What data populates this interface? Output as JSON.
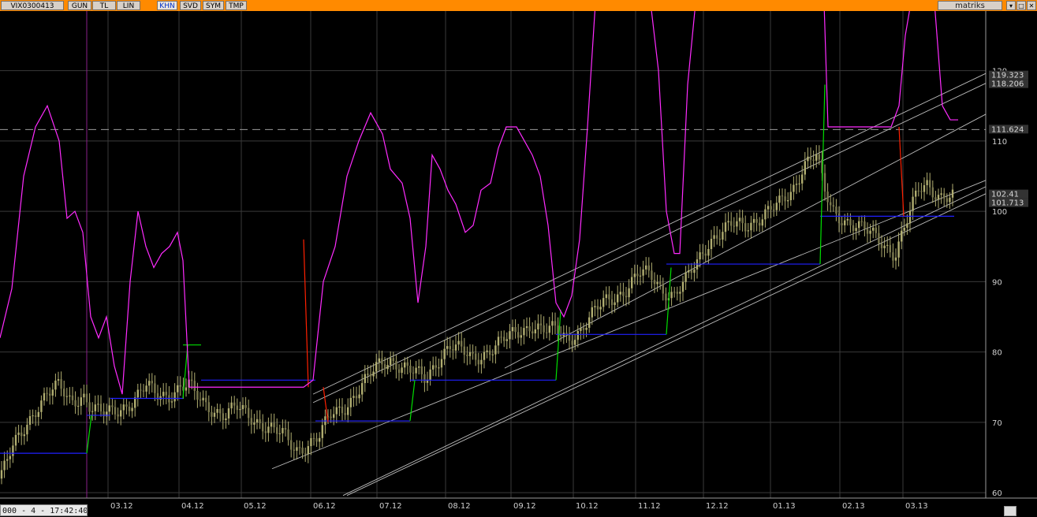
{
  "toolbar": {
    "symbol": "VIX0300413",
    "tabs": [
      "GUN",
      "TL",
      "LIN",
      "KHN",
      "SVD",
      "SYM",
      "TMP"
    ],
    "active_tab": "KHN",
    "brand": "matriks",
    "window_buttons": [
      "▾",
      "□",
      "✕"
    ]
  },
  "status_text": "000 - 4 - 17:42:40",
  "colors": {
    "background": "#000000",
    "grid": "#3a3a3a",
    "candle": "#b0ad70",
    "line_magenta": "#ff2bff",
    "stop_blue": "#2020ff",
    "stop_green": "#00e000",
    "stop_red": "#ff2000",
    "channel": "#bcbcbc",
    "topbar": "#ff8a00"
  },
  "chart_data": {
    "type": "line",
    "y_ticks": [
      60,
      70,
      80,
      90,
      100,
      110,
      120
    ],
    "ylim": [
      57,
      133
    ],
    "x_labels": [
      "03.12",
      "04.12",
      "05.12",
      "06.12",
      "07.12",
      "08.12",
      "09.12",
      "10.12",
      "11.12",
      "12.12",
      "01.13",
      "02.13",
      "03.13"
    ],
    "value_boxes": [
      {
        "label": "119.323",
        "value": 119.323
      },
      {
        "label": "118.206",
        "value": 118.206
      },
      {
        "label": "111.624",
        "value": 111.624
      },
      {
        "label": "102.41",
        "value": 102.41
      },
      {
        "label": "101.713",
        "value": 101.713
      }
    ],
    "horizontal_line": 111.624,
    "price_path": [
      [
        0,
        62
      ],
      [
        15,
        66
      ],
      [
        30,
        69
      ],
      [
        45,
        72
      ],
      [
        60,
        74
      ],
      [
        75,
        75
      ],
      [
        90,
        73
      ],
      [
        105,
        74
      ],
      [
        115,
        72
      ],
      [
        130,
        71
      ],
      [
        150,
        72
      ],
      [
        170,
        73
      ],
      [
        185,
        75
      ],
      [
        200,
        74
      ],
      [
        215,
        74
      ],
      [
        230,
        75
      ],
      [
        240,
        75
      ],
      [
        255,
        73
      ],
      [
        270,
        72
      ],
      [
        285,
        71
      ],
      [
        300,
        72
      ],
      [
        315,
        71
      ],
      [
        330,
        70
      ],
      [
        345,
        69
      ],
      [
        360,
        68
      ],
      [
        375,
        66
      ],
      [
        390,
        67
      ],
      [
        405,
        68
      ],
      [
        420,
        71
      ],
      [
        435,
        72
      ],
      [
        450,
        74
      ],
      [
        465,
        76
      ],
      [
        480,
        78
      ],
      [
        495,
        79
      ],
      [
        510,
        78
      ],
      [
        525,
        77
      ],
      [
        540,
        76
      ],
      [
        555,
        79
      ],
      [
        570,
        81
      ],
      [
        585,
        80
      ],
      [
        600,
        79
      ],
      [
        615,
        80
      ],
      [
        630,
        81
      ],
      [
        645,
        82
      ],
      [
        660,
        83
      ],
      [
        675,
        84
      ],
      [
        690,
        83
      ],
      [
        705,
        83
      ],
      [
        720,
        82
      ],
      [
        735,
        83
      ],
      [
        750,
        85
      ],
      [
        765,
        87
      ],
      [
        780,
        88
      ],
      [
        795,
        89
      ],
      [
        810,
        91
      ],
      [
        825,
        91
      ],
      [
        840,
        89
      ],
      [
        855,
        88
      ],
      [
        870,
        90
      ],
      [
        885,
        93
      ],
      [
        900,
        96
      ],
      [
        915,
        97
      ],
      [
        930,
        98
      ],
      [
        945,
        98
      ],
      [
        960,
        99
      ],
      [
        975,
        100
      ],
      [
        990,
        101
      ],
      [
        1005,
        103
      ],
      [
        1020,
        107
      ],
      [
        1035,
        108
      ],
      [
        1045,
        103
      ],
      [
        1055,
        100
      ],
      [
        1070,
        99
      ],
      [
        1085,
        98
      ],
      [
        1100,
        97
      ],
      [
        1115,
        96
      ],
      [
        1125,
        95
      ],
      [
        1135,
        94
      ],
      [
        1145,
        97
      ],
      [
        1155,
        100
      ],
      [
        1165,
        103
      ],
      [
        1175,
        104
      ],
      [
        1185,
        103
      ],
      [
        1195,
        102
      ],
      [
        1210,
        102
      ]
    ],
    "series": [
      {
        "type": "line",
        "color": "magenta",
        "points": [
          [
            0,
            82
          ],
          [
            15,
            89
          ],
          [
            30,
            105
          ],
          [
            45,
            112
          ],
          [
            60,
            115
          ],
          [
            75,
            110
          ],
          [
            85,
            99
          ],
          [
            95,
            100
          ],
          [
            105,
            97
          ],
          [
            115,
            85
          ],
          [
            125,
            82
          ],
          [
            135,
            85
          ],
          [
            145,
            78
          ],
          [
            155,
            74
          ],
          [
            165,
            90
          ],
          [
            175,
            100
          ],
          [
            185,
            95
          ],
          [
            195,
            92
          ],
          [
            205,
            94
          ],
          [
            215,
            95
          ],
          [
            225,
            97
          ],
          [
            232,
            93
          ],
          [
            240,
            75
          ],
          [
            270,
            75
          ],
          [
            300,
            75
          ],
          [
            330,
            75
          ],
          [
            360,
            75
          ],
          [
            385,
            75
          ],
          [
            397,
            76
          ],
          [
            410,
            90
          ],
          [
            425,
            95
          ],
          [
            440,
            105
          ],
          [
            455,
            110
          ],
          [
            470,
            114
          ],
          [
            485,
            111
          ],
          [
            495,
            106
          ],
          [
            510,
            104
          ],
          [
            520,
            99
          ],
          [
            530,
            87
          ],
          [
            540,
            95
          ],
          [
            548,
            108
          ],
          [
            558,
            106
          ],
          [
            568,
            103
          ],
          [
            578,
            101
          ],
          [
            590,
            97
          ],
          [
            600,
            98
          ],
          [
            610,
            103
          ],
          [
            622,
            104
          ],
          [
            632,
            109
          ],
          [
            642,
            112
          ],
          [
            655,
            112
          ],
          [
            665,
            110
          ],
          [
            675,
            108
          ],
          [
            685,
            105
          ],
          [
            695,
            98
          ],
          [
            705,
            87
          ],
          [
            715,
            85
          ],
          [
            725,
            88
          ],
          [
            735,
            96
          ],
          [
            745,
            112
          ],
          [
            755,
            130
          ],
          [
            765,
            145
          ],
          [
            825,
            145
          ],
          [
            835,
            120
          ],
          [
            845,
            100
          ],
          [
            855,
            94
          ],
          [
            862,
            94
          ],
          [
            872,
            118
          ],
          [
            882,
            145
          ],
          [
            1045,
            145
          ],
          [
            1050,
            112
          ],
          [
            1060,
            112
          ],
          [
            1070,
            112
          ],
          [
            1080,
            112
          ],
          [
            1090,
            112
          ],
          [
            1100,
            112
          ],
          [
            1110,
            112
          ],
          [
            1120,
            112
          ],
          [
            1130,
            112
          ],
          [
            1140,
            115
          ],
          [
            1148,
            125
          ],
          [
            1155,
            145
          ],
          [
            1185,
            145
          ],
          [
            1195,
            115
          ],
          [
            1205,
            113
          ],
          [
            1215,
            113
          ]
        ]
      },
      {
        "type": "step",
        "color": "stop",
        "segments": [
          [
            0,
            65.6,
            110,
            "blue"
          ],
          [
            110,
            71,
            140,
            "blue"
          ],
          [
            140,
            73.4,
            232,
            "blue"
          ],
          [
            232,
            81,
            255,
            "green"
          ],
          [
            255,
            76,
            400,
            "blue"
          ],
          [
            400,
            70.2,
            520,
            "blue"
          ],
          [
            520,
            76,
            705,
            "blue"
          ],
          [
            705,
            82.5,
            845,
            "blue"
          ],
          [
            845,
            92.5,
            1040,
            "blue"
          ],
          [
            1040,
            99.3,
            1210,
            "blue"
          ]
        ],
        "rises": [
          [
            110,
            65.6,
            71,
            "green"
          ],
          [
            232,
            73.4,
            81,
            "green"
          ],
          [
            520,
            70.2,
            76,
            "green"
          ],
          [
            705,
            76,
            86,
            "green"
          ],
          [
            845,
            82.5,
            92,
            "green"
          ],
          [
            1040,
            92.5,
            118,
            "green"
          ],
          [
            1140,
            112,
            99.3,
            "red"
          ],
          [
            385,
            96,
            75,
            "red"
          ],
          [
            410,
            75,
            70,
            "red"
          ]
        ]
      }
    ],
    "channels": [
      {
        "x1": 345,
        "y1": 63.4,
        "x2": 1250,
        "y2": 104.4
      },
      {
        "x1": 397,
        "y1": 74,
        "x2": 1250,
        "y2": 119.6
      },
      {
        "x1": 397,
        "y1": 72.8,
        "x2": 1250,
        "y2": 118.2
      },
      {
        "x1": 435,
        "y1": 59.6,
        "x2": 1250,
        "y2": 103.5
      },
      {
        "x1": 440,
        "y1": 59.6,
        "x2": 1250,
        "y2": 102.5
      },
      {
        "x1": 640,
        "y1": 77.7,
        "x2": 1250,
        "y2": 113.8
      }
    ]
  }
}
